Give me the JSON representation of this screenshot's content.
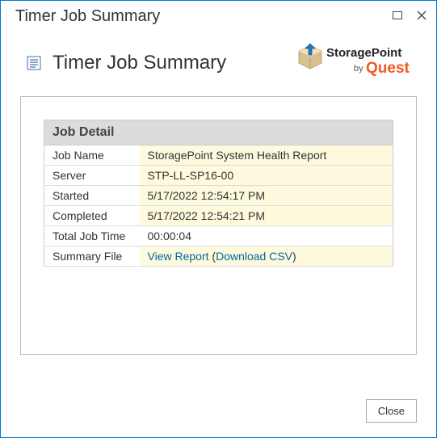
{
  "window": {
    "title": "Timer Job Summary"
  },
  "header": {
    "title": "Timer Job Summary",
    "brand_top": "StoragePoint",
    "brand_by": "by",
    "brand_name": "Quest"
  },
  "detail": {
    "section_title": "Job Detail",
    "rows": {
      "job_name_label": "Job Name",
      "job_name_value": "StoragePoint System Health Report",
      "server_label": "Server",
      "server_value": "STP-LL-SP16-00",
      "started_label": "Started",
      "started_value": "5/17/2022 12:54:17 PM",
      "completed_label": "Completed",
      "completed_value": "5/17/2022 12:54:21 PM",
      "total_time_label": "Total Job Time",
      "total_time_value": "00:00:04",
      "summary_file_label": "Summary File",
      "view_report_link": "View Report",
      "download_csv_link": "Download CSV"
    }
  },
  "footer": {
    "close_label": "Close"
  }
}
